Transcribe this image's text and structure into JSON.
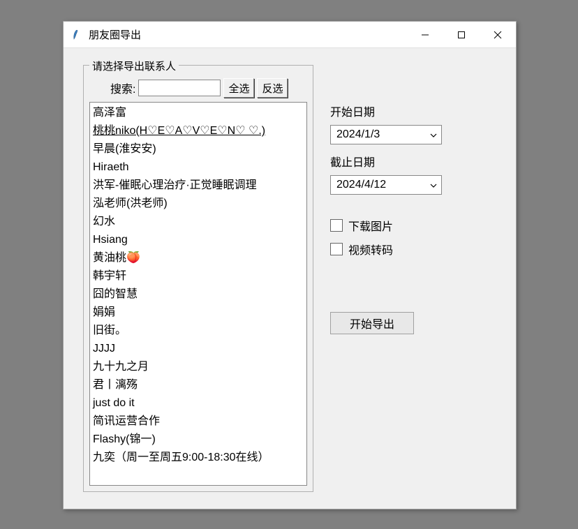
{
  "window": {
    "title": "朋友圈导出"
  },
  "group": {
    "legend": "请选择导出联系人",
    "search_label": "搜索:",
    "search_value": "",
    "select_all_label": "全选",
    "invert_label": "反选"
  },
  "contacts": [
    "高泽富",
    "桃桃niko(H♡E♡A♡V♡E♡N♡ ♡.)",
    "早晨(淮安安)",
    "Hiraeth",
    "洪军-催眠心理治疗·正觉睡眠调理",
    "泓老师(洪老师)",
    "幻水",
    "Hsiang",
    "黄油桃🍑",
    "韩宇轩",
    "囧的智慧",
    "娟娟",
    "旧街。",
    "JJJJ",
    "九十九之月",
    "君丨漓殇",
    "just do it",
    "简讯运营合作",
    "Flashy(锦一)",
    "九奕（周一至周五9:00-18:30在线）"
  ],
  "underline_index": 1,
  "dates": {
    "start_label": "开始日期",
    "start_value": "2024/1/3",
    "end_label": "截止日期",
    "end_value": "2024/4/12"
  },
  "options": {
    "download_images_label": "下载图片",
    "video_transcode_label": "视频转码"
  },
  "export_label": "开始导出"
}
